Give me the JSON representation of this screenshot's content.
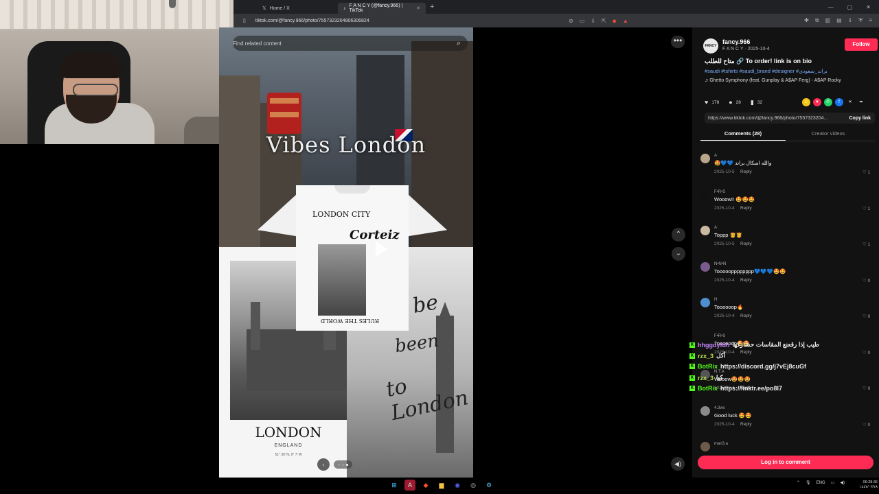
{
  "browser": {
    "tabs": [
      {
        "label": "Home / X",
        "active": false
      },
      {
        "label": "F A N C Y (@fancy.966) | TikTok",
        "active": true
      }
    ],
    "url": "tiktok.com/@fancy.966/photo/7557323204906306824"
  },
  "media": {
    "search_placeholder": "Find related content",
    "overlay_title": "Vibes London",
    "poster": {
      "title": "LONDON",
      "subtitle": "ENGLAND",
      "coords": "51° 30' N, 0° 7' W"
    },
    "script_words": [
      "be",
      "been",
      "to London"
    ],
    "tshirt": {
      "top_text": "LONDON CITY",
      "brand": "Corteiz",
      "bottom_text": "RULES THE WORLD"
    }
  },
  "post": {
    "author_avatar_text": "FANCY",
    "author": "fancy.966",
    "meta": "F A N C Y · 2025-10-4",
    "follow_label": "Follow",
    "caption": "متاح للطلب 🔗 To order! link is on bio",
    "hashtags": "#saudi #tshirts #saudi_brand #designer #براند_سعودي",
    "music": "♫  Ghetto Symphony (feat. Gunplay & A$AP Ferg) - A$AP Rocky",
    "likes": "178",
    "comments": "28",
    "saves": "32",
    "link": "https://www.tiktok.com/@fancy.966/photo/7557323204...",
    "copy_label": "Copy link",
    "tabs": [
      "Comments (28)",
      "Creator videos"
    ],
    "login_label": "Log in to comment"
  },
  "comments": [
    {
      "user": "A",
      "text": "🤩💙💙 والله اسكال براند",
      "date": "2025-10-5",
      "likes": "1",
      "avatar": "#b8a58c"
    },
    {
      "user": "F•R•S",
      "text": "Wooow!! 🤩🤩🤩",
      "date": "2025-10-4",
      "likes": "1",
      "avatar": "#111111"
    },
    {
      "user": "A",
      "text": "Toppp 🫅🫅",
      "date": "2025-10-5",
      "likes": "1",
      "avatar": "#c9b9a2"
    },
    {
      "user": "N•N•N",
      "text": "Tooooopppppppp💙💙💙🤩🤩",
      "date": "2025-10-4",
      "likes": "0",
      "avatar": "#7a5b8e"
    },
    {
      "user": "H",
      "text": "Toooooop🔥",
      "date": "2025-10-4",
      "likes": "0",
      "avatar": "#4f8ecf"
    },
    {
      "user": "F•R•S",
      "text": "Toooooop🤩🤩",
      "date": "2025-10-4",
      "likes": "0",
      "avatar": "#111111"
    },
    {
      "user": "N.T.A",
      "text": "Wooow🤩🤩🤩",
      "date": "2025-10-4",
      "likes": "0",
      "avatar": "#555555"
    },
    {
      "user": "4.3ws",
      "text": "Good luck 🤩🤩",
      "date": "2025-10-4",
      "likes": "0",
      "avatar": "#8a8a8a"
    },
    {
      "user": "man3.a",
      "text": "",
      "date": "",
      "likes": "",
      "avatar": "#6d5a4a"
    }
  ],
  "chat": [
    {
      "user": "hhggdyfdh",
      "msg": "طيب إذا رقعنع المقاسات حشاركها",
      "color": "pink"
    },
    {
      "user": "rzx_3",
      "msg": "أكل",
      "color": "gold"
    },
    {
      "user": "BotRix",
      "msg": "https://discord.gg/j7vEj8cuGf",
      "color": "green"
    },
    {
      "user": "rzx_3",
      "msg": "كيا",
      "color": "gold"
    },
    {
      "user": "BotRix",
      "msg": "https://linktr.ee/po8l7",
      "color": "green"
    }
  ],
  "taskbar": {
    "lang": "ENG",
    "time": "06:28:36",
    "date": "١٤٤٧/٠٣/٢٨"
  }
}
